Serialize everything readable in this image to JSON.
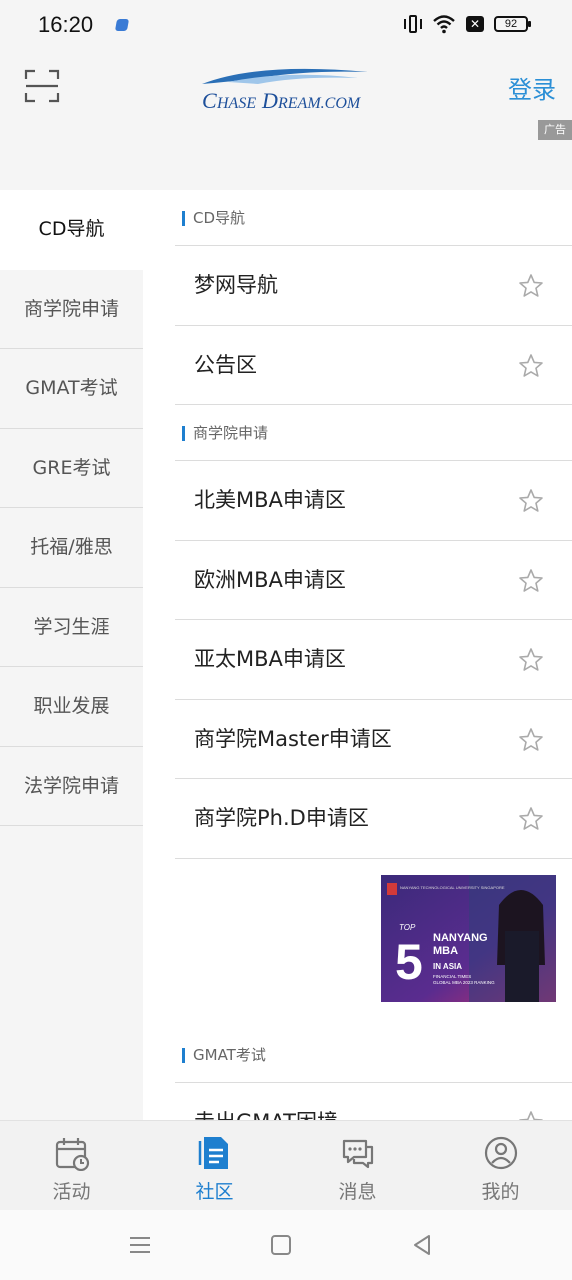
{
  "status_bar": {
    "time": "16:20",
    "battery": "92"
  },
  "header": {
    "logo_text": "ChaseDream.com",
    "login_label": "登录",
    "ad_tag": "广告"
  },
  "left_nav": {
    "items": [
      {
        "label": "CD导航",
        "active": true
      },
      {
        "label": "商学院申请",
        "active": false
      },
      {
        "label": "GMAT考试",
        "active": false
      },
      {
        "label": "GRE考试",
        "active": false
      },
      {
        "label": "托福/雅思",
        "active": false
      },
      {
        "label": "学习生涯",
        "active": false
      },
      {
        "label": "职业发展",
        "active": false
      },
      {
        "label": "法学院申请",
        "active": false
      }
    ]
  },
  "content": {
    "sections": [
      {
        "title": "CD导航",
        "rows": [
          "梦网导航",
          "公告区"
        ]
      },
      {
        "title": "商学院申请",
        "rows": [
          "北美MBA申请区",
          "欧洲MBA申请区",
          "亚太MBA申请区",
          "商学院Master申请区",
          "商学院Ph.D申请区"
        ]
      },
      {
        "title": "GMAT考试",
        "rows": [
          "走出GMAT困境"
        ]
      }
    ],
    "ad_banner": {
      "top": "TOP",
      "number": "5",
      "line1": "NANYANG",
      "line2": "MBA",
      "line3": "IN ASIA",
      "caption1": "FINANCIAL TIMES",
      "caption2": "GLOBAL MBA 2023 RANKING",
      "univ": "NANYANG TECHNOLOGICAL UNIVERSITY SINGAPORE"
    }
  },
  "tab_bar": {
    "tabs": [
      {
        "label": "活动",
        "icon": "calendar-clock-icon",
        "active": false
      },
      {
        "label": "社区",
        "icon": "document-icon",
        "active": true
      },
      {
        "label": "消息",
        "icon": "chat-bubbles-icon",
        "active": false
      },
      {
        "label": "我的",
        "icon": "user-circle-icon",
        "active": false
      }
    ]
  },
  "colors": {
    "accent": "#1e7fcf",
    "login": "#2b8fd6",
    "background": "#f5f5f5"
  }
}
